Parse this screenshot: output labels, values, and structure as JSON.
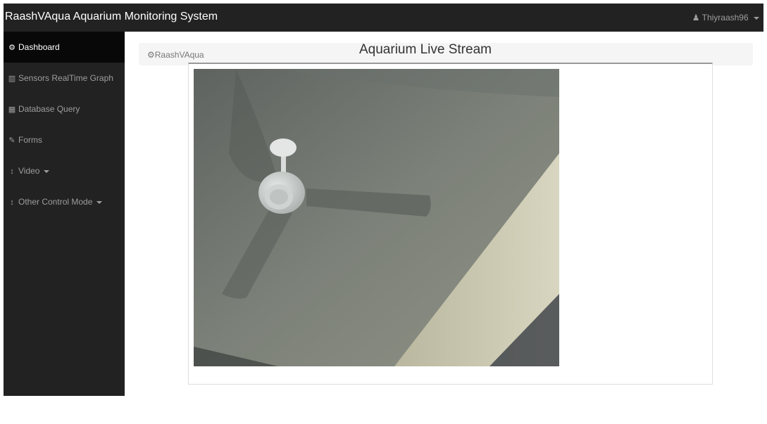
{
  "app": {
    "title": "RaashVAqua Aquarium Monitoring System",
    "user_label": "Thiyraash96"
  },
  "sidebar": {
    "items": [
      {
        "icon": "dashboard-icon",
        "glyph": "⚙",
        "label": "Dashboard"
      },
      {
        "icon": "bar-chart-icon",
        "glyph": "▥",
        "label": "Sensors RealTime Graph"
      },
      {
        "icon": "table-icon",
        "glyph": "▦",
        "label": "Database Query"
      },
      {
        "icon": "edit-icon",
        "glyph": "✎",
        "label": "Forms"
      },
      {
        "icon": "vertical-arrows-icon",
        "glyph": "↕",
        "label": "Video"
      },
      {
        "icon": "vertical-arrows-icon",
        "glyph": "↕",
        "label": "Other Control Mode"
      }
    ]
  },
  "breadcrumb": {
    "icon": "dashboard-icon",
    "label": "RaashVAqua"
  },
  "main": {
    "title": "Aquarium Live Stream"
  },
  "colors": {
    "navbar": "#222222",
    "active_item": "#080808",
    "nav_text": "#9d9d9d",
    "breadcrumb_bg": "#f5f5f5"
  }
}
